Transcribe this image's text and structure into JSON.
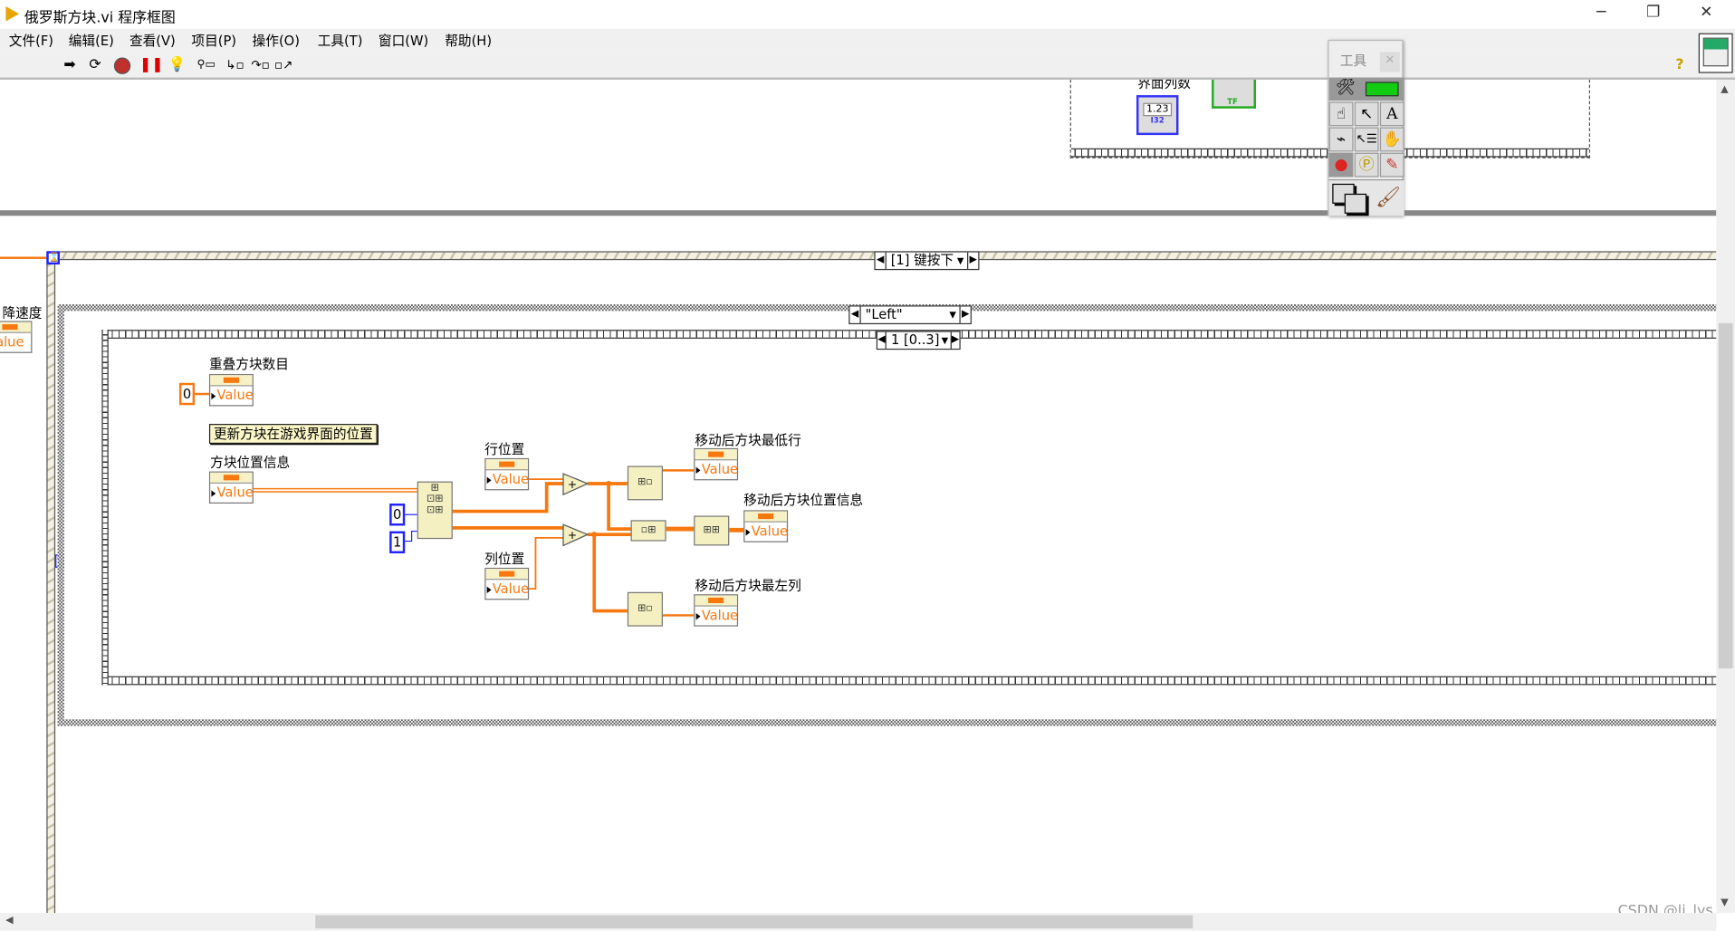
{
  "window": {
    "title": "俄罗斯方块.vi 程序框图",
    "minimize": "─",
    "restore": "❐",
    "close": "✕"
  },
  "menu": [
    "文件(F)",
    "编辑(E)",
    "查看(V)",
    "项目(P)",
    "操作(O)",
    "工具(T)",
    "窗口(W)",
    "帮助(H)"
  ],
  "toolbar": {
    "run": "run-icon",
    "run_continuous": "run-continuously-icon",
    "abort": "abort-icon",
    "pause": "pause-icon",
    "highlight": "highlight-execution-icon",
    "retain": "retain-wire-values-icon",
    "step_into": "step-into-icon",
    "step_over": "step-over-icon",
    "step_out": "step-out-icon",
    "help": "?"
  },
  "tools_palette": {
    "title": "工具",
    "close": "×"
  },
  "upper": {
    "label": "界面列数",
    "numeric": "1.23",
    "type": "I32",
    "bool": "TF"
  },
  "left_partial": {
    "label": "降速度",
    "value": "alue"
  },
  "event_structure": {
    "selector": "[1] 键按下"
  },
  "case_structure": {
    "selector": "\"Left\""
  },
  "sequence": {
    "selector": "1 [0..3]"
  },
  "diagram": {
    "overlap_count": {
      "label": "重叠方块数目",
      "value": "Value",
      "constant": "0"
    },
    "comment": "更新方块在游戏界面的位置",
    "block_pos": {
      "label": "方块位置信息",
      "value": "Value"
    },
    "index_consts": [
      "0",
      "1"
    ],
    "row_pos": {
      "label": "行位置",
      "value": "Value"
    },
    "col_pos": {
      "label": "列位置",
      "value": "Value"
    },
    "lowest_row": {
      "label": "移动后方块最低行",
      "value": "Value"
    },
    "new_pos": {
      "label": "移动后方块位置信息",
      "value": "Value"
    },
    "leftmost_col": {
      "label": "移动后方块最左列",
      "value": "Value"
    },
    "add_symbol": "+"
  },
  "colors": {
    "wire_int": "#f7780f",
    "const_blue": "#1a1aff",
    "node": "#f4f0c2"
  },
  "watermark": "CSDN @li_lys"
}
